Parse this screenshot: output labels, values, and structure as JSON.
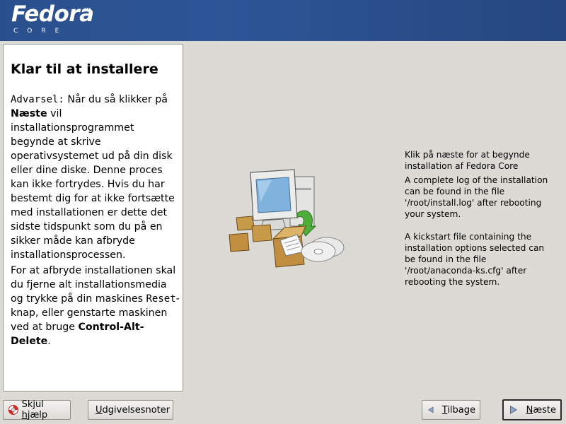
{
  "header": {
    "logo_word": "Fedora",
    "logo_sub": "CORE",
    "trademark": "TM"
  },
  "help": {
    "title": "Klar til at installere",
    "p1": {
      "warning_label": "Advarsel:",
      "t1": " Når du så klikker på ",
      "next_word": "Næste",
      "t2": " vil installationsprogrammet begynde at skrive operativsystemet ud på din disk eller dine diske. Denne proces kan ikke fortrydes. Hvis du har bestemt dig for at ikke fortsætte med installationen er dette det sidste tidspunkt som du på en sikker måde kan afbryde installationsprocessen."
    },
    "p2": {
      "t1": "For at afbryde installationen skal du fjerne alt installationsmedia og trykke på din maskines ",
      "reset_word": "Reset",
      "t2": "-knap, eller genstarte maskinen ved at bruge ",
      "keys": "Control-Alt-Delete",
      "t3": "."
    }
  },
  "info": {
    "line1": "Klik på næste for at begynde installation af Fedora Core",
    "line2": "A complete log of the installation can be found in the file '/root/install.log' after rebooting your system.",
    "line3": "A kickstart file containing the installation options selected can be found in the file '/root/anaconda-ks.cfg' after rebooting the system."
  },
  "buttons": {
    "hide_help": {
      "pre": "Skjul ",
      "mnemonic": "h",
      "post": "jælp"
    },
    "release_notes": {
      "pre": "",
      "mnemonic": "U",
      "post": "dgivelsesnoter"
    },
    "back": {
      "pre": "",
      "mnemonic": "T",
      "post": "ilbage"
    },
    "next": {
      "pre": "",
      "mnemonic": "N",
      "post": "æste"
    }
  },
  "icons": {
    "hide_help": "lifebuoy-icon",
    "release_notes": "document-icon",
    "back": "arrow-left-icon",
    "next": "arrow-right-icon"
  },
  "colors": {
    "banner": "#2d5597",
    "background": "#dcdad5",
    "panel": "#ffffff"
  }
}
